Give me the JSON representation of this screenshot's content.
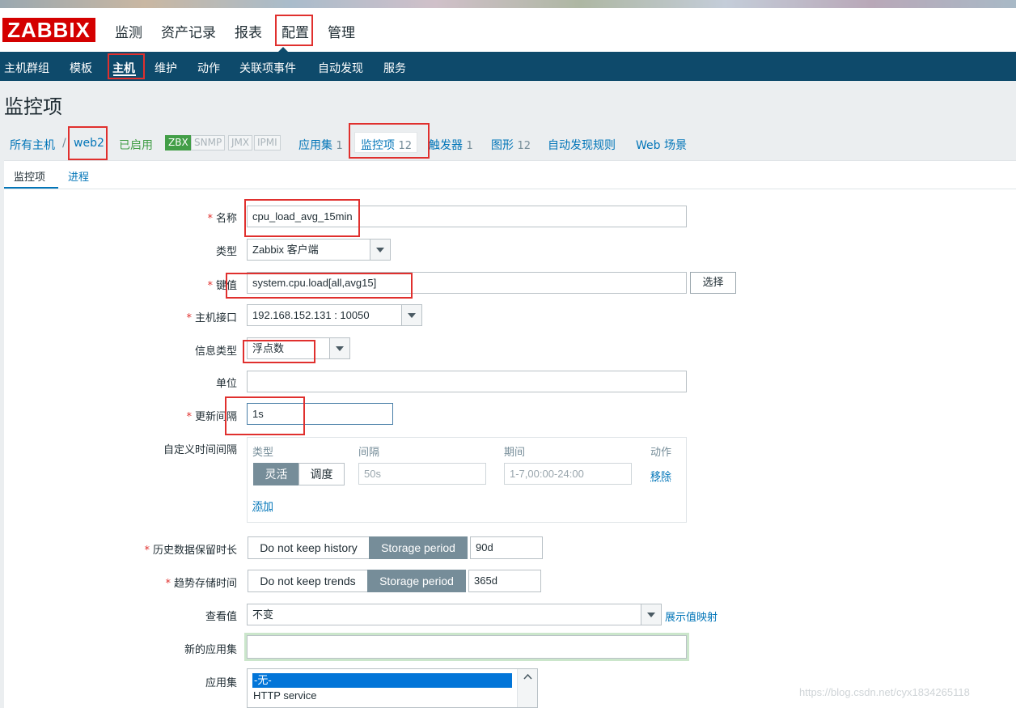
{
  "logo": "ZABBIX",
  "main_menu": [
    "监测",
    "资产记录",
    "报表",
    "配置",
    "管理"
  ],
  "sub_menu": [
    "主机群组",
    "模板",
    "主机",
    "维护",
    "动作",
    "关联项事件",
    "自动发现",
    "服务"
  ],
  "page_title": "监控项",
  "breadcrumbs": {
    "all_hosts": "所有主机",
    "separator": "/",
    "host": "web2",
    "status": "已启用",
    "interfaces": [
      "ZBX",
      "SNMP",
      "JMX",
      "IPMI"
    ],
    "tabs": [
      {
        "label": "应用集",
        "count": "1"
      },
      {
        "label": "监控项",
        "count": "12"
      },
      {
        "label": "触发器",
        "count": "1"
      },
      {
        "label": "图形",
        "count": "12"
      },
      {
        "label": "自动发现规则",
        "count": ""
      },
      {
        "label": "Web 场景",
        "count": ""
      }
    ]
  },
  "form_tabs": [
    "监控项",
    "进程"
  ],
  "form": {
    "required_mark": "*",
    "name_label": "名称",
    "name_value": "cpu_load_avg_15min",
    "type_label": "类型",
    "type_value": "Zabbix 客户端",
    "key_label": "键值",
    "key_value": "system.cpu.load[all,avg15]",
    "select_button": "选择",
    "host_interface_label": "主机接口",
    "host_interface_value": "192.168.152.131 : 10050",
    "info_type_label": "信息类型",
    "info_type_value": "浮点数",
    "units_label": "单位",
    "units_value": "",
    "update_interval_label": "更新间隔",
    "update_interval_value": "1s",
    "custom_intervals_label": "自定义时间间隔",
    "custom_intervals": {
      "col_type": "类型",
      "col_interval": "间隔",
      "col_period": "期间",
      "col_action": "动作",
      "flexible": "灵活",
      "scheduling": "调度",
      "interval_placeholder": "50s",
      "period_placeholder": "1-7,00:00-24:00",
      "remove": "移除",
      "add": "添加"
    },
    "history_label": "历史数据保留时长",
    "history_no_keep": "Do not keep history",
    "history_storage": "Storage period",
    "history_value": "90d",
    "trends_label": "趋势存储时间",
    "trends_no_keep": "Do not keep trends",
    "trends_storage": "Storage period",
    "trends_value": "365d",
    "show_value_label": "查看值",
    "show_value_value": "不变",
    "show_value_mappings": "展示值映射",
    "new_app_label": "新的应用集",
    "new_app_value": "",
    "applications_label": "应用集",
    "applications": [
      "-无-",
      "HTTP service"
    ]
  },
  "watermark": "https://blog.csdn.net/cyx1834265118",
  "colors": {
    "brand_red": "#d40000",
    "nav_blue": "#0e4a6b",
    "link_blue": "#0275b8",
    "enabled_green": "#429e47",
    "annotation_red": "#e0302e",
    "toggle_active": "#768d99"
  }
}
